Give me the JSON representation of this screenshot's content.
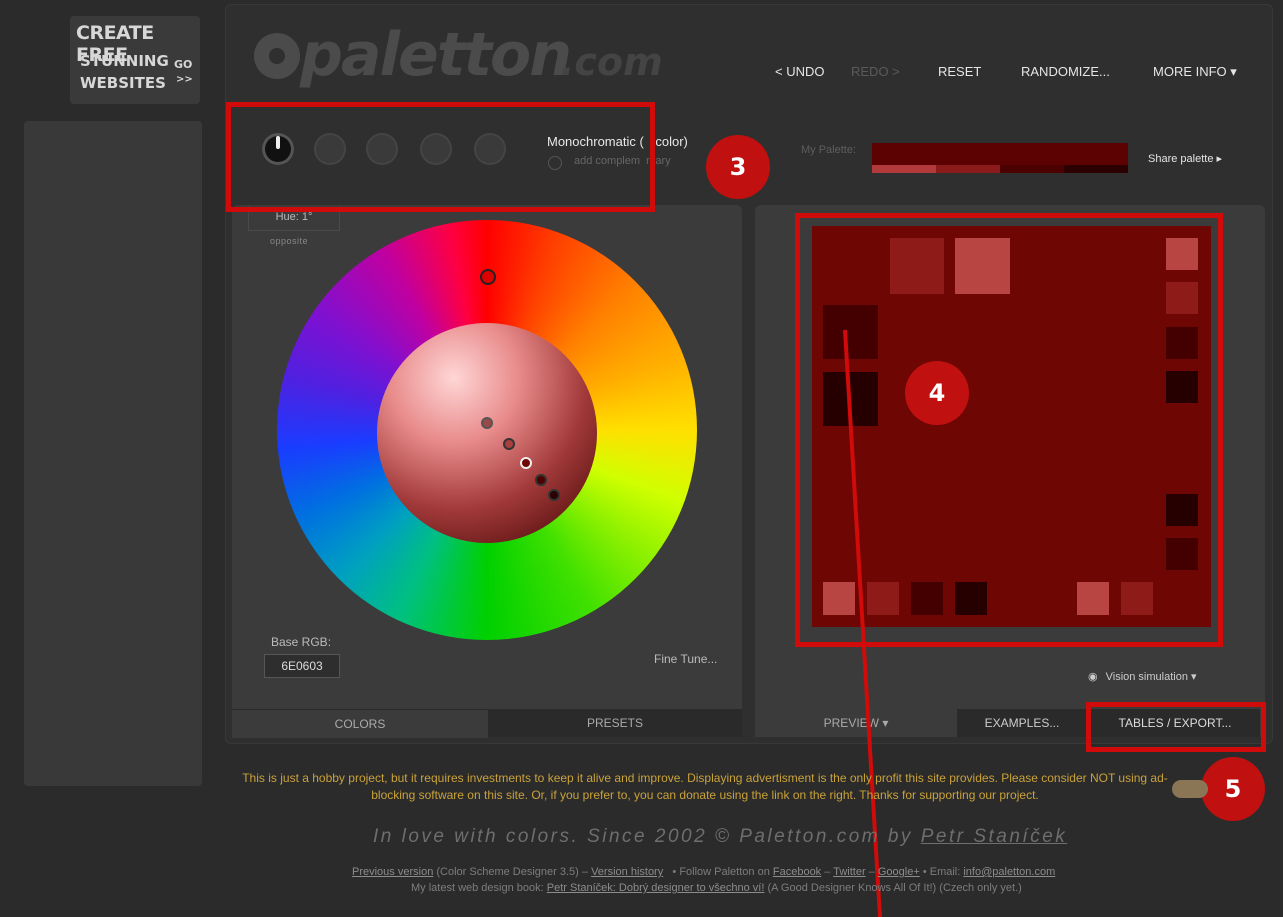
{
  "promo": {
    "line1": "CREATE FREE",
    "line2": "STUNNING",
    "line3": "WEBSITES",
    "go": "GO",
    ">>": ">>"
  },
  "logo": {
    "name": "paletton",
    "domain": ".com"
  },
  "nav": {
    "undo": "< UNDO",
    "redo": "REDO >",
    "reset": "RESET",
    "randomize": "RANDOMIZE...",
    "more": "MORE INFO ▾"
  },
  "scheme": {
    "mode": "Monochromatic (1-color)",
    "mode_visible": "Monochromatic (",
    "mode_tail": "-color)",
    "add_comp": "add complementary",
    "add_comp_visible": "add complem",
    "add_comp_tail": "ntary",
    "icons": [
      "mono-icon",
      "adjacent-icon",
      "triad-icon",
      "tetrad-icon",
      "free-style-icon"
    ]
  },
  "palette": {
    "label": "My Palette:",
    "share": "Share palette ▸",
    "colors": [
      "#b23a3a",
      "#8b1a1a",
      "#4b0101",
      "#2a0000"
    ]
  },
  "colors_panel": {
    "hue": "Hue: 1°",
    "opposite": "opposite",
    "base_rgb_label": "Base RGB:",
    "base_rgb": "6E0603",
    "fine_tune": "Fine Tune..."
  },
  "left_tabs": {
    "colors": "COLORS",
    "presets": "PRESETS"
  },
  "right_tabs": {
    "preview": "PREVIEW ▾",
    "examples": "EXAMPLES...",
    "tables": "TABLES / EXPORT..."
  },
  "vision": "Vision simulation ▾",
  "badges": {
    "three": "3",
    "four": "4",
    "five": "5"
  },
  "note": "This is just a hobby project, but it requires investments to keep it alive and improve. Displaying advertisment is the only profit this site provides. Please consider NOT using ad-blocking software on this site. Or, if you prefer to, you can donate using the link on the right. Thanks for supporting our project.",
  "tagline": {
    "text": "In love with colors. Since 2002 © Paletton.com by ",
    "author": "Petr Staníček"
  },
  "footer": {
    "prev": "Previous version",
    "prev_note": "(Color Scheme Designer 3.5) –",
    "history": "Version history",
    "follow": "• Follow Paletton on",
    "facebook": "Facebook",
    "twitter": "Twitter",
    "google": "Google+",
    "email_label": "• Email:",
    "email": "info@paletton.com",
    "book_intro": "My latest web design book:",
    "book": "Petr Staníček: Dobrý designer to všechno ví!",
    "book_note": "(A Good Designer Knows All Of It!) (Czech only yet.)"
  },
  "preview_colors": {
    "base": "#6e0603",
    "light": "#b94542",
    "mid": "#8e1b18",
    "dark": "#440000",
    "darker": "#260000"
  }
}
